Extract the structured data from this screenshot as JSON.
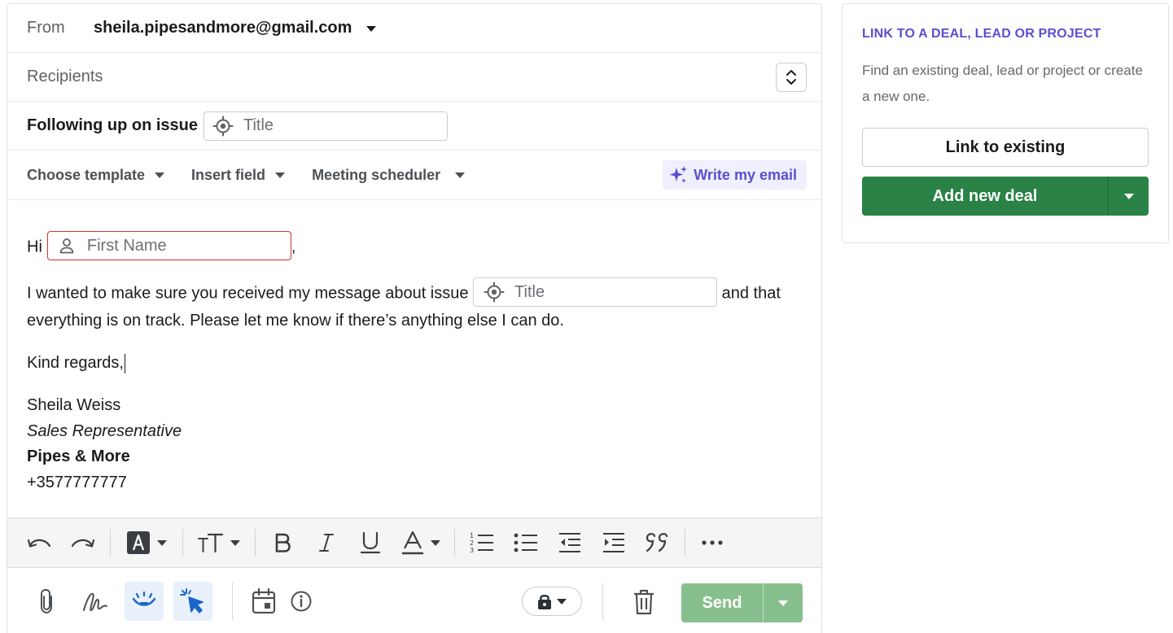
{
  "compose": {
    "from_label": "From",
    "from_email": "sheila.pipesandmore@gmail.com",
    "recipients_label": "Recipients",
    "subject_text": "Following up on issue",
    "subject_field_placeholder": "Title",
    "toolbar": {
      "choose_template": "Choose template",
      "insert_field": "Insert field",
      "meeting_scheduler": "Meeting scheduler",
      "write_my_email": "Write my email"
    },
    "body": {
      "greeting": "Hi",
      "first_name_placeholder": "First Name",
      "greeting_suffix": ",",
      "para1_before": "I wanted to make sure you received my message about issue",
      "title_placeholder": "Title",
      "para1_after": "and that everything is on track. Please let me know if there’s anything else I can do.",
      "closing": "Kind regards,",
      "signature": {
        "name": "Sheila Weiss",
        "role": "Sales Representative",
        "company": "Pipes & More",
        "phone": "+3577777777"
      }
    },
    "send_label": "Send"
  },
  "side": {
    "title": "LINK TO A DEAL, LEAD OR PROJECT",
    "description": "Find an existing deal, lead or project or create a new one.",
    "link_existing": "Link to existing",
    "add_new_deal": "Add new deal"
  },
  "colors": {
    "accent_purple": "#5a4fcf",
    "add_green": "#2a8246",
    "send_green_disabled": "#87c08e",
    "error_red": "#d2332a"
  },
  "icons": [
    "chevron-down-icon",
    "sort-stepper-icon",
    "target-icon",
    "sparkle-icon",
    "person-icon",
    "undo-icon",
    "redo-icon",
    "text-highlight-icon",
    "text-size-icon",
    "bold-icon",
    "italic-icon",
    "underline-icon",
    "text-color-icon",
    "numbered-list-icon",
    "bullet-list-icon",
    "outdent-icon",
    "indent-icon",
    "quote-icon",
    "more-icon",
    "paperclip-icon",
    "signature-icon",
    "eye-tracking-icon",
    "click-tracking-icon",
    "calendar-icon",
    "info-icon",
    "lock-icon",
    "trash-icon"
  ]
}
